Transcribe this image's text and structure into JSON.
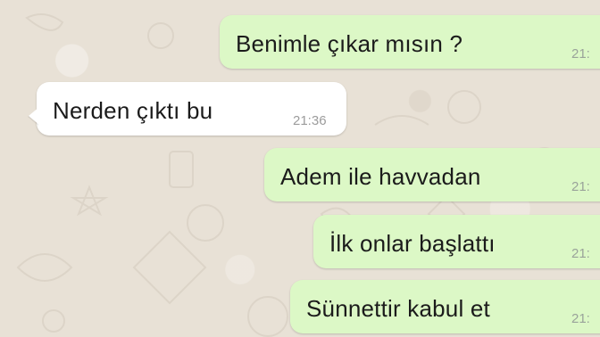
{
  "messages": [
    {
      "direction": "out",
      "text": "Benimle çıkar mısın ?",
      "time": "21:"
    },
    {
      "direction": "in",
      "text": "Nerden çıktı bu",
      "time": "21:36"
    },
    {
      "direction": "out",
      "text": "Adem ile havvadan",
      "time": "21:"
    },
    {
      "direction": "out",
      "text": "İlk onlar başlattı",
      "time": "21:"
    },
    {
      "direction": "out",
      "text": "Sünnettir kabul et",
      "time": "21:"
    }
  ],
  "colors": {
    "outgoing_bubble": "#dcf8c6",
    "incoming_bubble": "#ffffff",
    "wallpaper": "#e8e1d6"
  }
}
